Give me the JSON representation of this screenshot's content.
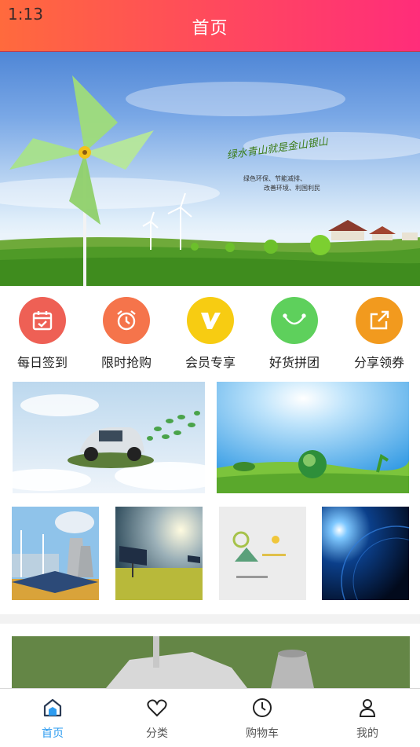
{
  "status_bar": {
    "time": "1:13"
  },
  "header": {
    "title": "首页"
  },
  "banner": {
    "slogan": "绿水青山就是金山银山",
    "subtext_line1": "绿色环保、节能减排、",
    "subtext_line2": "改善环境、利国利民"
  },
  "quick_menu": [
    {
      "label": "每日签到",
      "icon": "calendar-check-icon",
      "color": "#ee6055"
    },
    {
      "label": "限时抢购",
      "icon": "alarm-clock-icon",
      "color": "#f5744b"
    },
    {
      "label": "会员专享",
      "icon": "vip-v-icon",
      "color": "#f7cc12"
    },
    {
      "label": "好货拼团",
      "icon": "smile-arc-icon",
      "color": "#5ed05c"
    },
    {
      "label": "分享领券",
      "icon": "share-arrow-icon",
      "color": "#f29a1e"
    }
  ],
  "tabbar": {
    "items": [
      {
        "label": "首页",
        "icon": "home-icon",
        "active": true
      },
      {
        "label": "分类",
        "icon": "heart-icon",
        "active": false
      },
      {
        "label": "购物车",
        "icon": "clock-icon",
        "active": false
      },
      {
        "label": "我的",
        "icon": "user-icon",
        "active": false
      }
    ]
  },
  "colors": {
    "header_start": "#ff6a3d",
    "header_end": "#ff2d7a",
    "tab_active": "#2e9cf0"
  }
}
